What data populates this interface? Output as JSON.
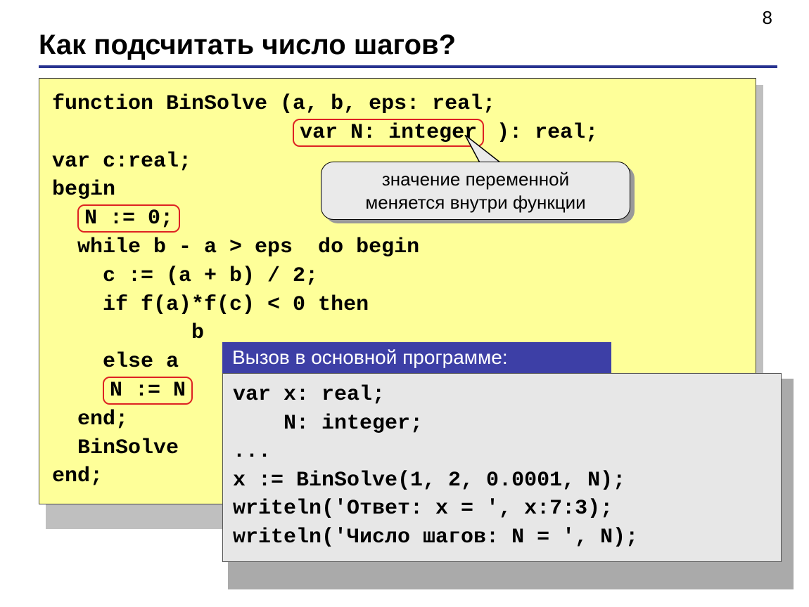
{
  "page_number": "8",
  "title": "Как подсчитать число шагов?",
  "code": {
    "l1_a": "function BinSolve (a, b, eps: real;",
    "l2_pre": "                   ",
    "l2_box": "var N: integer",
    "l2_post": " ): real;",
    "l3": "var c:real;",
    "l4": "begin",
    "l5_pre": "  ",
    "l5_box": "N := 0;",
    "l6": "  while b - a > eps  do begin",
    "l7": "    c := (a + b) / 2;",
    "l8": "    if f(a)*f(c) < 0 then",
    "l9": "           b",
    "l10": "    else a",
    "l11_pre": "    ",
    "l11_box": "N := N",
    "l12": "  end;",
    "l13": "  BinSolve",
    "l14": "end;"
  },
  "callout": {
    "line1": "значение переменной",
    "line2": "меняется внутри функции"
  },
  "grey": {
    "title": "Вызов в основной программе:",
    "l1": "var x: real;",
    "l2": "    N: integer;",
    "l3": "...",
    "l4": "x := BinSolve(1, 2, 0.0001, N);",
    "l5": "writeln('Ответ: x = ', x:7:3);",
    "l6": "writeln('Число шагов: N = ', N);"
  }
}
